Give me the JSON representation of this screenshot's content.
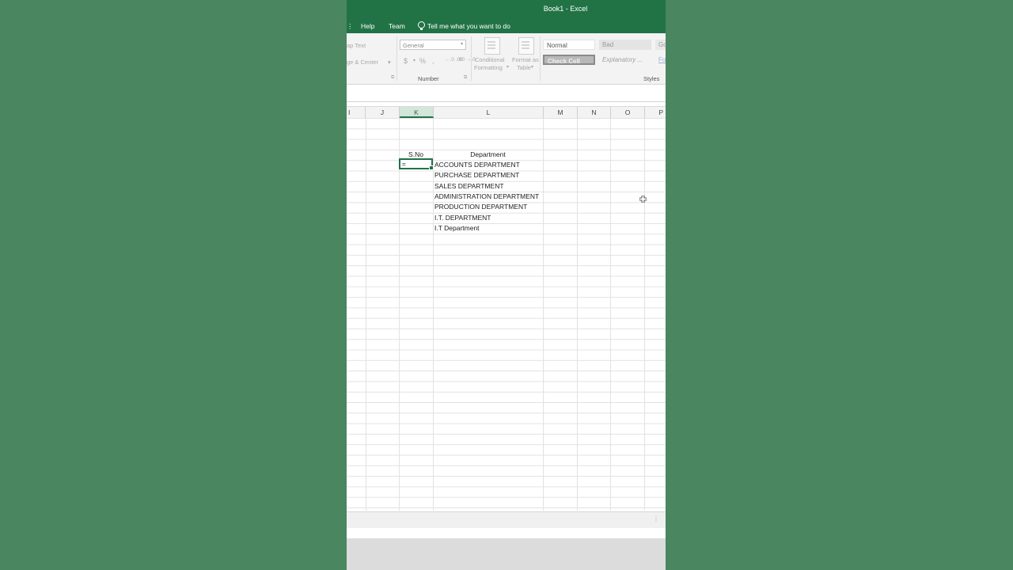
{
  "window": {
    "title": "Book1  -  Excel"
  },
  "tabs": [
    "Help",
    "Team"
  ],
  "tell_me": "Tell me what you want to do",
  "ribbon": {
    "wrap_text": "ap Text",
    "merge_center": "ge & Center",
    "number_format": "General",
    "currency": "$",
    "percent": "%",
    "comma": ",",
    "inc_decimal": "←.0 .00",
    "dec_decimal": ".00 →.0",
    "number_group": "Number",
    "cond_format_1": "Conditional",
    "cond_format_2": "Formatting",
    "format_table_1": "Format as",
    "format_table_2": "Table",
    "styles": {
      "normal": "Normal",
      "bad": "Bad",
      "good": "Go",
      "check_cell": "Check Cell",
      "explanatory": "Explanatory ...",
      "followed": "Fo"
    },
    "styles_group": "Styles"
  },
  "columns": [
    "I",
    "J",
    "K",
    "L",
    "M",
    "N",
    "O",
    "P"
  ],
  "active_column": "K",
  "sheet": {
    "header_sno": "S.No",
    "header_department": "Department",
    "active_cell_entry": "=",
    "departments": [
      "ACCOUNTS DEPARTMENT",
      "PURCHASE DEPARTMENT",
      "SALES DEPARTMENT",
      "ADMINISTRATION DEPARTMENT",
      "PRODUCTION DEPARTMENT",
      "I.T. DEPARTMENT",
      "I.T Department"
    ]
  },
  "colors": {
    "excel_green": "#217346",
    "background": "#4a8660"
  }
}
